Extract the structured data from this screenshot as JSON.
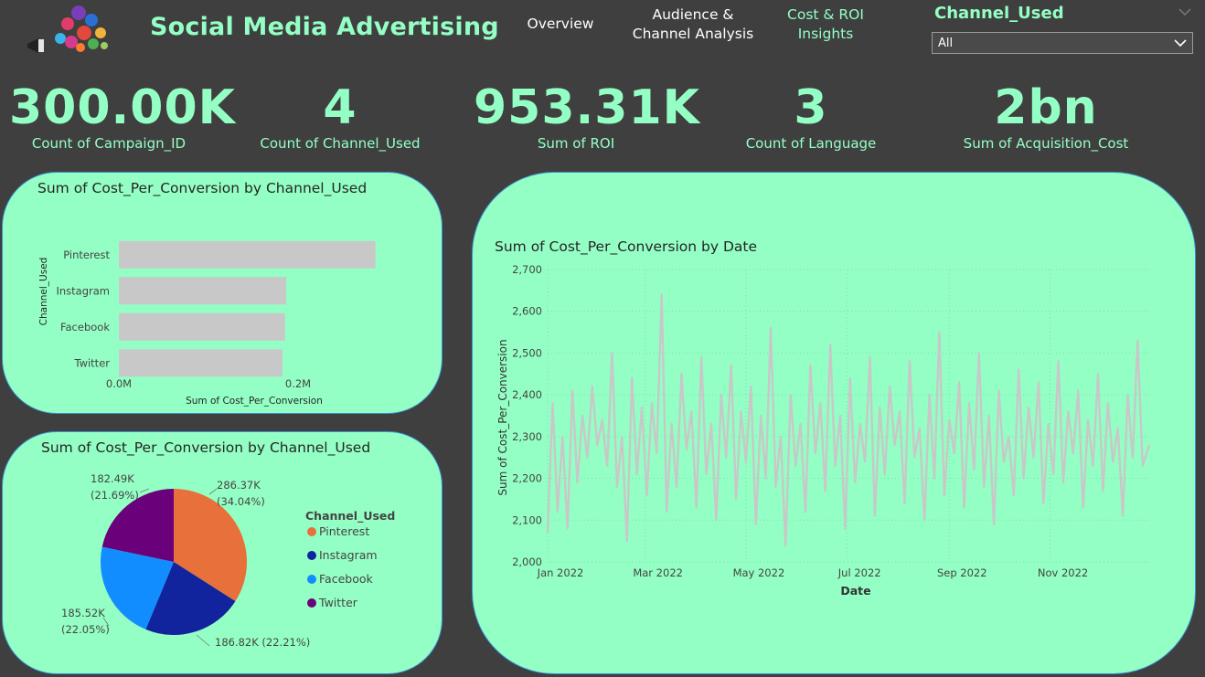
{
  "header": {
    "title": "Social Media Advertising",
    "nav": {
      "overview": "Overview",
      "audience_line1": "Audience &",
      "audience_line2": "Channel Analysis",
      "cost_line1": "Cost & ROI",
      "cost_line2": "Insights"
    },
    "logo_icon": "social-media-megaphone-icon"
  },
  "slicer": {
    "title": "Channel_Used",
    "value": "All"
  },
  "kpis": [
    {
      "value": "300.00K",
      "label": "Count of Campaign_ID"
    },
    {
      "value": "4",
      "label": "Count of Channel_Used"
    },
    {
      "value": "953.31K",
      "label": "Sum of ROI"
    },
    {
      "value": "3",
      "label": "Count of Language"
    },
    {
      "value": "2bn",
      "label": "Sum of Acquisition_Cost"
    }
  ],
  "bar_card": {
    "title": "Sum of Cost_Per_Conversion by Channel_Used"
  },
  "pie_card": {
    "title": "Sum of Cost_Per_Conversion by Channel_Used",
    "legend_title": "Channel_Used"
  },
  "line_card": {
    "title": "Sum of Cost_Per_Conversion by Date"
  },
  "colors": {
    "accent": "#94ffc4",
    "background": "#3f3f3f",
    "bar": "#c8c8c8",
    "pinterest": "#e8703a",
    "instagram": "#12239e",
    "facebook": "#118dff",
    "twitter": "#6b007b"
  },
  "chart_data": [
    {
      "type": "bar",
      "orientation": "horizontal",
      "title": "Sum of Cost_Per_Conversion by Channel_Used",
      "categories": [
        "Pinterest",
        "Instagram",
        "Facebook",
        "Twitter"
      ],
      "values": [
        286370,
        186820,
        185520,
        182490
      ],
      "xlabel": "Sum of Cost_Per_Conversion",
      "ylabel": "Channel_Used",
      "xticks": [
        "0.0M",
        "0.2M"
      ],
      "xlim": [
        0,
        0.2
      ],
      "tick_values": [
        0,
        0.2
      ]
    },
    {
      "type": "pie",
      "title": "Sum of Cost_Per_Conversion by Channel_Used",
      "legend_title": "Channel_Used",
      "categories": [
        "Pinterest",
        "Instagram",
        "Facebook",
        "Twitter"
      ],
      "values": [
        286370,
        186820,
        185520,
        182490
      ],
      "labels": [
        "286.37K (34.04%)",
        "186.82K (22.21%)",
        "185.52K (22.05%)",
        "182.49K (21.69%)"
      ],
      "label_values": [
        "286.37K",
        "186.82K",
        "185.52K",
        "182.49K"
      ],
      "label_pcts": [
        "(34.04%)",
        "(22.21%)",
        "(22.05%)",
        "(21.69%)"
      ],
      "legend_position": "right"
    },
    {
      "type": "line",
      "title": "Sum of Cost_Per_Conversion by Date",
      "xlabel": "Date",
      "ylabel": "Sum of Cost_Per_Conversion",
      "ylim": [
        2000,
        2700
      ],
      "yticks": [
        "2,000",
        "2,100",
        "2,200",
        "2,300",
        "2,400",
        "2,500",
        "2,600",
        "2,700"
      ],
      "xticks": [
        "Jan 2022",
        "Mar 2022",
        "May 2022",
        "Jul 2022",
        "Sep 2022",
        "Nov 2022"
      ],
      "x_start": "2022-01-01",
      "x_end": "2022-12-31",
      "points": [
        [
          "2022-01-01",
          2070
        ],
        [
          "2022-01-04",
          2380
        ],
        [
          "2022-01-07",
          2120
        ],
        [
          "2022-01-10",
          2300
        ],
        [
          "2022-01-13",
          2080
        ],
        [
          "2022-01-16",
          2410
        ],
        [
          "2022-01-19",
          2190
        ],
        [
          "2022-01-22",
          2350
        ],
        [
          "2022-01-25",
          2250
        ],
        [
          "2022-01-28",
          2420
        ],
        [
          "2022-01-31",
          2280
        ],
        [
          "2022-02-03",
          2340
        ],
        [
          "2022-02-06",
          2230
        ],
        [
          "2022-02-09",
          2500
        ],
        [
          "2022-02-12",
          2180
        ],
        [
          "2022-02-15",
          2300
        ],
        [
          "2022-02-18",
          2050
        ],
        [
          "2022-02-21",
          2440
        ],
        [
          "2022-02-24",
          2210
        ],
        [
          "2022-02-27",
          2370
        ],
        [
          "2022-03-02",
          2160
        ],
        [
          "2022-03-05",
          2380
        ],
        [
          "2022-03-08",
          2260
        ],
        [
          "2022-03-11",
          2640
        ],
        [
          "2022-03-14",
          2120
        ],
        [
          "2022-03-17",
          2330
        ],
        [
          "2022-03-20",
          2180
        ],
        [
          "2022-03-23",
          2450
        ],
        [
          "2022-03-26",
          2270
        ],
        [
          "2022-03-29",
          2360
        ],
        [
          "2022-04-01",
          2130
        ],
        [
          "2022-04-04",
          2490
        ],
        [
          "2022-04-07",
          2210
        ],
        [
          "2022-04-10",
          2330
        ],
        [
          "2022-04-13",
          2100
        ],
        [
          "2022-04-16",
          2400
        ],
        [
          "2022-04-19",
          2250
        ],
        [
          "2022-04-22",
          2470
        ],
        [
          "2022-04-25",
          2150
        ],
        [
          "2022-04-28",
          2360
        ],
        [
          "2022-05-01",
          2240
        ],
        [
          "2022-05-04",
          2420
        ],
        [
          "2022-05-07",
          2090
        ],
        [
          "2022-05-10",
          2350
        ],
        [
          "2022-05-13",
          2200
        ],
        [
          "2022-05-16",
          2560
        ],
        [
          "2022-05-19",
          2180
        ],
        [
          "2022-05-22",
          2300
        ],
        [
          "2022-05-25",
          2040
        ],
        [
          "2022-05-28",
          2400
        ],
        [
          "2022-05-31",
          2230
        ],
        [
          "2022-06-03",
          2330
        ],
        [
          "2022-06-06",
          2120
        ],
        [
          "2022-06-09",
          2470
        ],
        [
          "2022-06-12",
          2260
        ],
        [
          "2022-06-15",
          2380
        ],
        [
          "2022-06-18",
          2170
        ],
        [
          "2022-06-21",
          2520
        ],
        [
          "2022-06-24",
          2230
        ],
        [
          "2022-06-27",
          2350
        ],
        [
          "2022-06-30",
          2080
        ],
        [
          "2022-07-03",
          2440
        ],
        [
          "2022-07-06",
          2190
        ],
        [
          "2022-07-09",
          2330
        ],
        [
          "2022-07-12",
          2240
        ],
        [
          "2022-07-15",
          2490
        ],
        [
          "2022-07-18",
          2110
        ],
        [
          "2022-07-21",
          2370
        ],
        [
          "2022-07-24",
          2210
        ],
        [
          "2022-07-27",
          2420
        ],
        [
          "2022-07-30",
          2280
        ],
        [
          "2022-08-02",
          2360
        ],
        [
          "2022-08-05",
          2140
        ],
        [
          "2022-08-08",
          2480
        ],
        [
          "2022-08-11",
          2250
        ],
        [
          "2022-08-14",
          2320
        ],
        [
          "2022-08-17",
          2100
        ],
        [
          "2022-08-20",
          2400
        ],
        [
          "2022-08-23",
          2200
        ],
        [
          "2022-08-26",
          2550
        ],
        [
          "2022-08-29",
          2160
        ],
        [
          "2022-09-01",
          2340
        ],
        [
          "2022-09-04",
          2260
        ],
        [
          "2022-09-07",
          2430
        ],
        [
          "2022-09-10",
          2130
        ],
        [
          "2022-09-13",
          2380
        ],
        [
          "2022-09-16",
          2220
        ],
        [
          "2022-09-19",
          2500
        ],
        [
          "2022-09-22",
          2180
        ],
        [
          "2022-09-25",
          2350
        ],
        [
          "2022-09-28",
          2090
        ],
        [
          "2022-10-01",
          2410
        ],
        [
          "2022-10-04",
          2240
        ],
        [
          "2022-10-07",
          2300
        ],
        [
          "2022-10-10",
          2160
        ],
        [
          "2022-10-13",
          2460
        ],
        [
          "2022-10-16",
          2200
        ],
        [
          "2022-10-19",
          2370
        ],
        [
          "2022-10-22",
          2250
        ],
        [
          "2022-10-25",
          2430
        ],
        [
          "2022-10-28",
          2140
        ],
        [
          "2022-10-31",
          2330
        ],
        [
          "2022-11-03",
          2210
        ],
        [
          "2022-11-06",
          2480
        ],
        [
          "2022-11-09",
          2190
        ],
        [
          "2022-11-12",
          2360
        ],
        [
          "2022-11-15",
          2260
        ],
        [
          "2022-11-18",
          2410
        ],
        [
          "2022-11-21",
          2130
        ],
        [
          "2022-11-24",
          2340
        ],
        [
          "2022-11-27",
          2230
        ],
        [
          "2022-11-30",
          2450
        ],
        [
          "2022-12-03",
          2170
        ],
        [
          "2022-12-06",
          2380
        ],
        [
          "2022-12-09",
          2240
        ],
        [
          "2022-12-12",
          2320
        ],
        [
          "2022-12-15",
          2110
        ],
        [
          "2022-12-18",
          2400
        ],
        [
          "2022-12-21",
          2250
        ],
        [
          "2022-12-24",
          2530
        ],
        [
          "2022-12-27",
          2230
        ],
        [
          "2022-12-31",
          2280
        ]
      ]
    }
  ]
}
